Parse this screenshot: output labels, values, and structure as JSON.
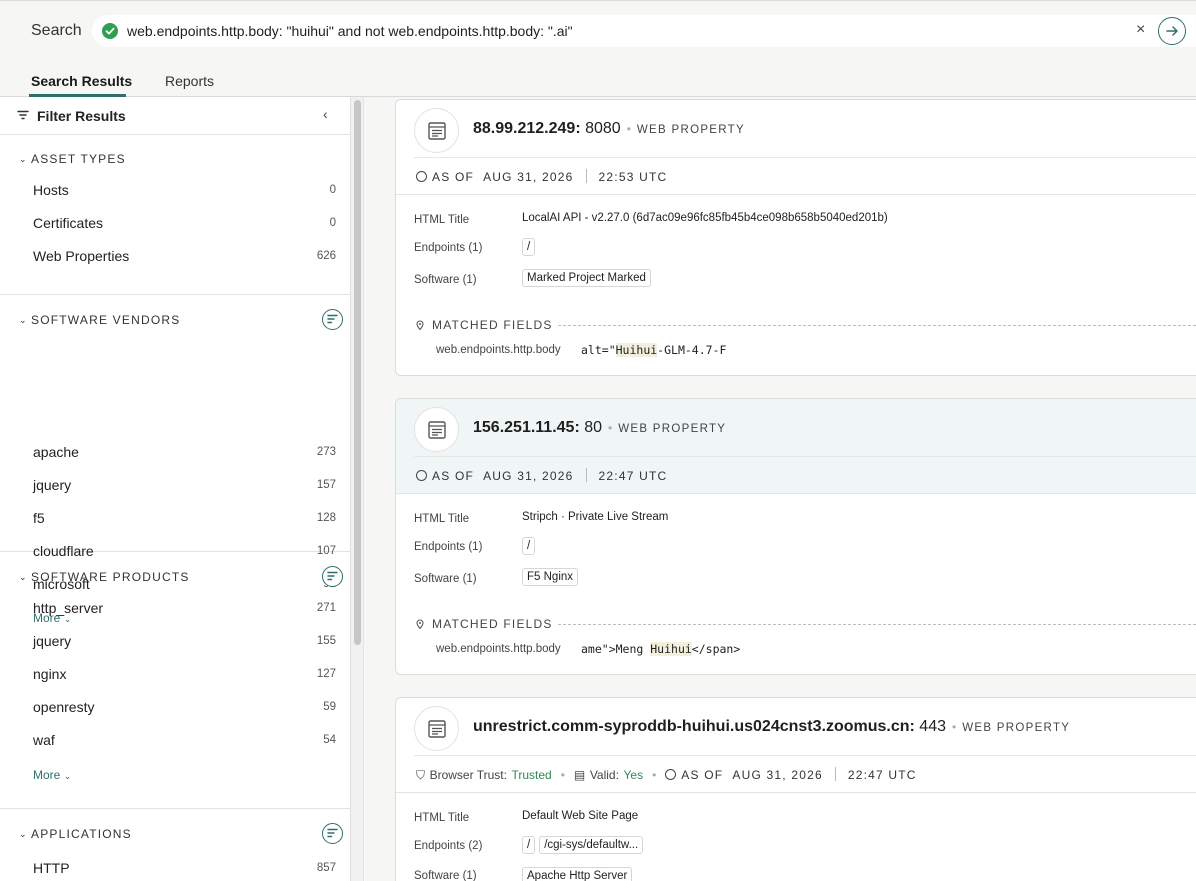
{
  "search": {
    "label": "Search",
    "query": "web.endpoints.http.body: \"huihui\" and not web.endpoints.http.body: \".ai\"",
    "clear": "×"
  },
  "tabs": [
    "Search Results",
    "Reports"
  ],
  "sidebar": {
    "title": "Filter Results",
    "collapse": "‹",
    "sections": [
      {
        "title": "ASSET TYPES",
        "items": [
          {
            "label": "Hosts",
            "count": "0"
          },
          {
            "label": "Certificates",
            "count": "0"
          },
          {
            "label": "Web Properties",
            "count": "626"
          }
        ]
      },
      {
        "title": "SOFTWARE VENDORS",
        "items": [
          {
            "label": "apache",
            "count": "273"
          },
          {
            "label": "jquery",
            "count": "157"
          },
          {
            "label": "f5",
            "count": "128"
          },
          {
            "label": "cloudflare",
            "count": "107"
          },
          {
            "label": "microsoft",
            "count": "92"
          }
        ],
        "more": "More"
      },
      {
        "title": "SOFTWARE PRODUCTS",
        "items": [
          {
            "label": "http_server",
            "count": "271"
          },
          {
            "label": "jquery",
            "count": "155"
          },
          {
            "label": "nginx",
            "count": "127"
          },
          {
            "label": "openresty",
            "count": "59"
          },
          {
            "label": "waf",
            "count": "54"
          }
        ],
        "more": "More"
      },
      {
        "title": "APPLICATIONS",
        "items": [
          {
            "label": "HTTP",
            "count": "857"
          }
        ]
      }
    ]
  },
  "results": [
    {
      "host": "88.99.212.249:",
      "port": "8080",
      "kind": "WEB PROPERTY",
      "as_of_label": "AS OF",
      "date": "AUG 31, 2026",
      "time": "22:53 UTC",
      "html_title_label": "HTML Title",
      "html_title": "LocalAI API - v2.27.0 (6d7ac09e96fc85fb45b4ce098b658b5040ed201b)",
      "endpoints_label": "Endpoints (1)",
      "endpoints": [
        "/"
      ],
      "software_label": "Software (1)",
      "software": [
        "Marked Project Marked"
      ],
      "matched_label": "MATCHED FIELDS",
      "matched_key": "web.endpoints.http.body",
      "matched_pre": "alt=\"",
      "matched_hl": "Huihui",
      "matched_post": "-GLM-4.7-F"
    },
    {
      "host": "156.251.11.45:",
      "port": "80",
      "kind": "WEB PROPERTY",
      "as_of_label": "AS OF",
      "date": "AUG 31, 2026",
      "time": "22:47 UTC",
      "html_title_label": "HTML Title",
      "html_title": "Stripch · Private Live Stream",
      "endpoints_label": "Endpoints (1)",
      "endpoints": [
        "/"
      ],
      "software_label": "Software (1)",
      "software": [
        "F5 Nginx"
      ],
      "matched_label": "MATCHED FIELDS",
      "matched_key": "web.endpoints.http.body",
      "matched_pre": "ame\">Meng ",
      "matched_hl": "Huihui",
      "matched_post": "</span>"
    },
    {
      "host": "unrestrict.comm-syproddb-huihui.us024cnst3.zoomus.cn:",
      "port": "443",
      "kind": "WEB PROPERTY",
      "browser_trust_label": "Browser Trust:",
      "browser_trust": "Trusted",
      "valid_label": "Valid:",
      "valid": "Yes",
      "as_of_label": "AS OF",
      "date": "AUG 31, 2026",
      "time": "22:47 UTC",
      "html_title_label": "HTML Title",
      "html_title": "Default Web Site Page",
      "endpoints_label": "Endpoints (2)",
      "endpoints": [
        "/",
        "/cgi-sys/defaultw..."
      ],
      "software_label": "Software (1)",
      "software": [
        "Apache Http Server"
      ]
    }
  ],
  "colors": {
    "accent": "#2f6f6a",
    "success": "#2e9e4f",
    "trusted": "#2e8b57"
  }
}
